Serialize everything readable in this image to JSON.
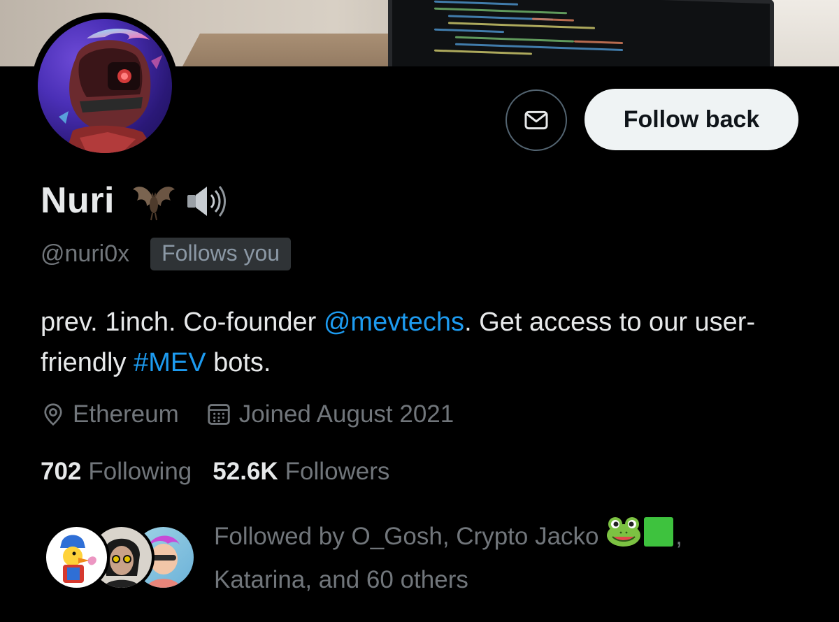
{
  "profile": {
    "display_name": "Nuri",
    "name_icons": [
      "bat-icon",
      "speaker-icon"
    ],
    "handle": "@nuri0x",
    "follows_you_badge": "Follows you",
    "follow_button_label": "Follow back",
    "message_button_icon": "envelope-icon"
  },
  "bio": {
    "part1": "prev. 1inch. Co-founder ",
    "mention": "@mevtechs",
    "part2": ". Get access to our user-friendly ",
    "hashtag": "#MEV",
    "part3": " bots."
  },
  "meta": {
    "location": "Ethereum",
    "location_icon": "location-pin-icon",
    "joined": "Joined August 2021",
    "joined_icon": "calendar-icon"
  },
  "stats": {
    "following_count": "702",
    "following_label": "Following",
    "followers_count": "52.6K",
    "followers_label": "Followers"
  },
  "followed_by": {
    "line1": "Followed by O_Gosh, Crypto Jacko",
    "line1_icons": [
      "frog-icon",
      "green-square-icon"
    ],
    "line1_suffix": ",",
    "line2": "Katarina, and 60 others"
  },
  "colors": {
    "background": "#000000",
    "link": "#1d9bf0",
    "primary_text": "#e7e9ea",
    "secondary_text": "#71767b",
    "follow_button_bg": "#eff3f4"
  }
}
